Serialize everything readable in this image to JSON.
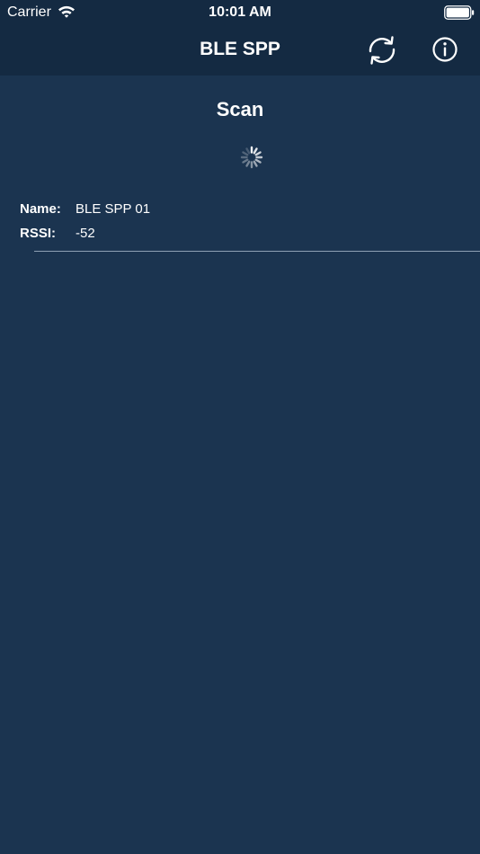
{
  "status_bar": {
    "carrier": "Carrier",
    "time": "10:01 AM",
    "wifi_icon": "wifi-icon",
    "battery_icon": "battery-icon"
  },
  "navbar": {
    "title": "BLE SPP",
    "refresh_icon": "refresh-icon",
    "info_icon": "info-icon"
  },
  "scan": {
    "title": "Scan",
    "spinner_icon": "spinner-icon"
  },
  "devices": [
    {
      "name_label": "Name:",
      "name": "BLE SPP 01",
      "rssi_label": "RSSI:",
      "rssi": "-52"
    }
  ],
  "colors": {
    "background": "#1b3450",
    "navbar": "#142a42",
    "text": "#ffffff",
    "separator": "#8ea0b3"
  }
}
